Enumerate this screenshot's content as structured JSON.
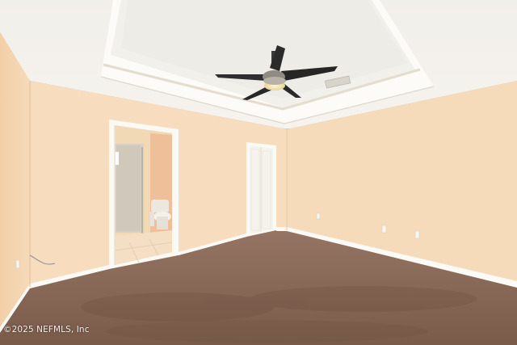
{
  "watermark": {
    "text": "©2025 NEFMLS, Inc"
  },
  "colors": {
    "wall": "#f6dcbc",
    "wall_shadow": "#eecfac",
    "ceiling": "#f4f1ec",
    "trim": "#fbfaf6",
    "carpet": "#8b6b57",
    "tile": "#f3ddc0",
    "fan_blade": "#2b2b2b",
    "fan_light": "#f3e6bf"
  },
  "icons": {
    "fan": "ceiling-fan-icon",
    "vent": "ceiling-vent-icon",
    "toilet": "toilet-icon",
    "outlet": "wall-outlet-icon"
  }
}
